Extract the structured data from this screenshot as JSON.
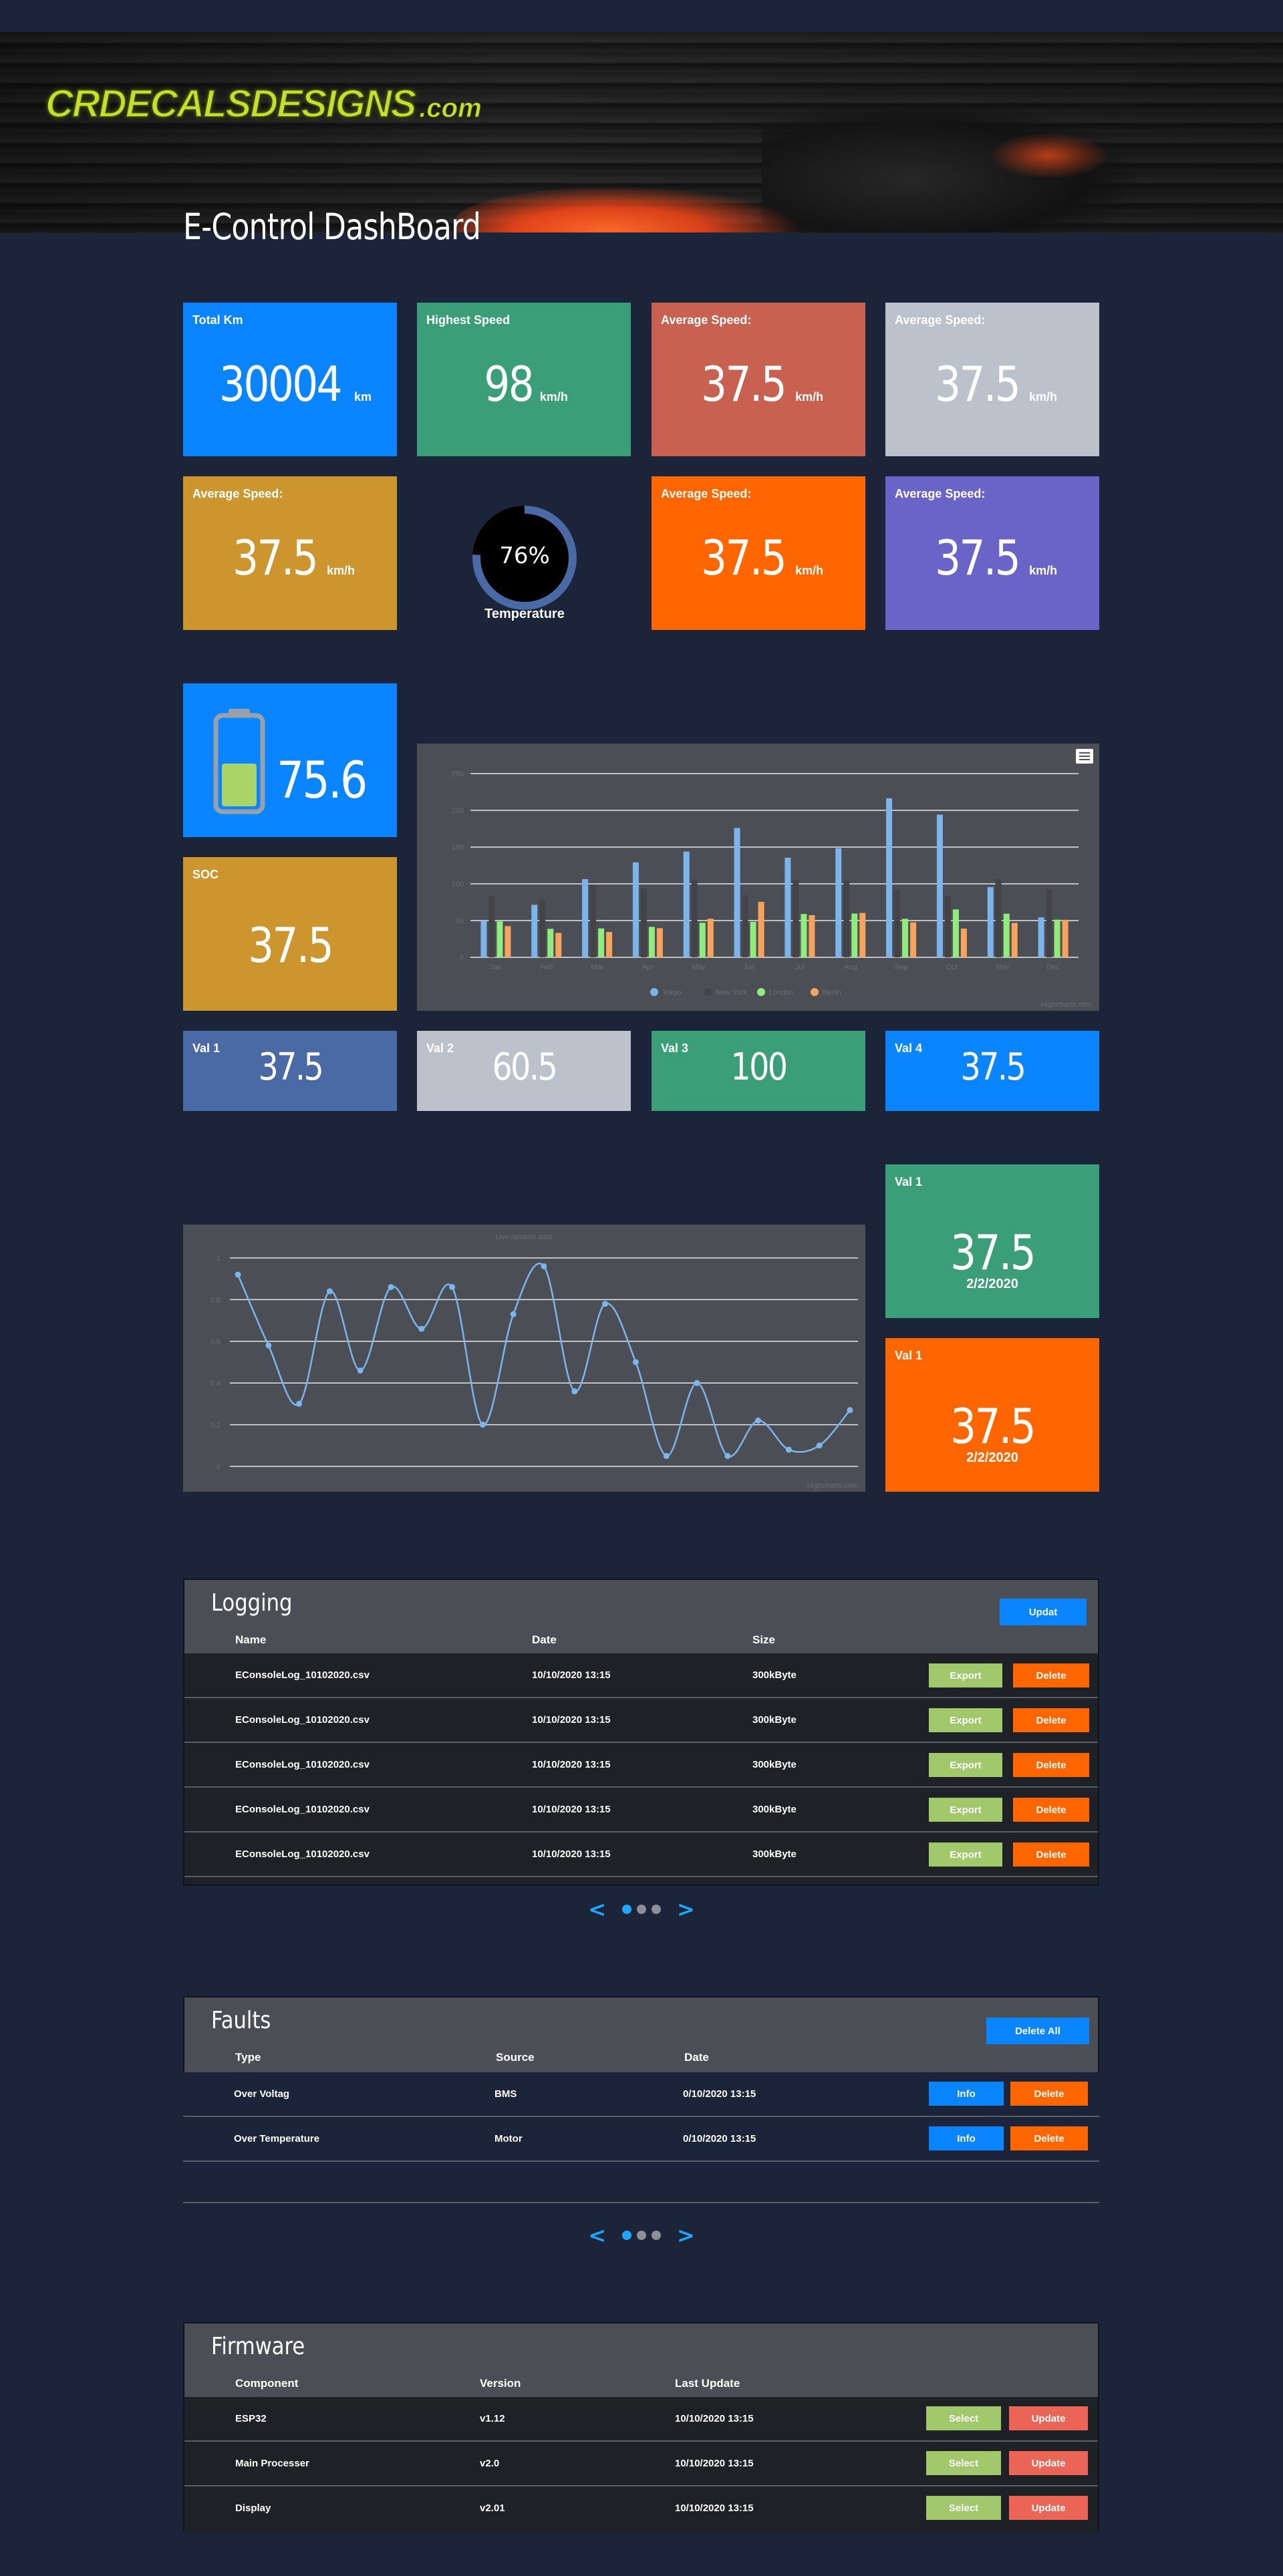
{
  "page_title": "E-Control DashBoard",
  "logo": {
    "part1": "CRDECALSDESIGNS",
    "part2": ".com"
  },
  "stats": [
    {
      "label": "Total Km",
      "value": "30004",
      "unit": "km",
      "color": "#0a84ff"
    },
    {
      "label": "Highest Speed",
      "value": "98",
      "unit": "km/h",
      "color": "#3a9e78"
    },
    {
      "label": "Average Speed:",
      "value": "37.5",
      "unit": "km/h",
      "color": "#c8614f"
    },
    {
      "label": "Average Speed:",
      "value": "37.5",
      "unit": "km/h",
      "color": "#bcc2cb"
    },
    {
      "label": "Average Speed:",
      "value": "37.5",
      "unit": "km/h",
      "color": "#cc952d"
    },
    {
      "label": "Average Speed:",
      "value": "37.5",
      "unit": "km/h",
      "color": "#ff6600"
    },
    {
      "label": "Average Speed:",
      "value": "37.5",
      "unit": "km/h",
      "color": "#6a63c8"
    }
  ],
  "gauge": {
    "percent": "76%",
    "fraction": 0.76,
    "label": "Temperature",
    "color": "#4a6aa6"
  },
  "battery": {
    "value": "75.6",
    "level": 0.5
  },
  "soc": {
    "label": "SOC",
    "value": "37.5"
  },
  "vals": [
    {
      "label": "Val 1",
      "value": "37.5",
      "color": "#4a6aa6"
    },
    {
      "label": "Val 2",
      "value": "60.5",
      "color": "#bcc2cb"
    },
    {
      "label": "Val 3",
      "value": "100",
      "color": "#3a9e78"
    },
    {
      "label": "Val 4",
      "value": "37.5",
      "color": "#0a84ff"
    }
  ],
  "side_cards": [
    {
      "label": "Val 1",
      "value": "37.5",
      "date": "2/2/2020",
      "color": "#3a9e78"
    },
    {
      "label": "Val 1",
      "value": "37.5",
      "date": "2/2/2020",
      "color": "#ff6600"
    }
  ],
  "chart_data": [
    {
      "type": "bar",
      "title": "",
      "categories": [
        "Jan",
        "Feb",
        "Mar",
        "Apr",
        "May",
        "Jun",
        "Jul",
        "Aug",
        "Sep",
        "Oct",
        "Nov",
        "Dec"
      ],
      "ylim": [
        0,
        250
      ],
      "yticks": [
        "0",
        "50",
        "100",
        "150",
        "200",
        "250"
      ],
      "series": [
        {
          "name": "Tokyo",
          "color": "#7cb5ec",
          "values": [
            49.9,
            71.5,
            106.4,
            129.2,
            144.0,
            176.0,
            135.6,
            148.5,
            216.4,
            194.1,
            95.6,
            54.4
          ]
        },
        {
          "name": "New York",
          "color": "#434348",
          "values": [
            83.6,
            78.8,
            98.5,
            93.4,
            106.0,
            84.5,
            105.0,
            104.3,
            91.2,
            83.5,
            106.6,
            92.3
          ]
        },
        {
          "name": "London",
          "color": "#90ed7d",
          "values": [
            48.9,
            38.8,
            39.3,
            41.4,
            47.0,
            48.3,
            59.0,
            59.6,
            52.4,
            65.2,
            59.3,
            51.2
          ]
        },
        {
          "name": "Berlin",
          "color": "#f7a35c",
          "values": [
            42.4,
            33.2,
            34.5,
            39.7,
            52.6,
            75.5,
            57.4,
            60.4,
            47.6,
            39.1,
            46.8,
            51.1
          ]
        }
      ],
      "grid": true,
      "legend": "bottom-center",
      "credit": "Highcharts.com"
    },
    {
      "type": "line",
      "title": "Live random data",
      "ylim": [
        0,
        1
      ],
      "yticks": [
        "0",
        "0.2",
        "0.4",
        "0.6",
        "0.8",
        "1"
      ],
      "series": [
        {
          "color": "#7cb5ec",
          "values": [
            0.92,
            0.58,
            0.3,
            0.84,
            0.46,
            0.86,
            0.66,
            0.86,
            0.2,
            0.73,
            0.96,
            0.36,
            0.78,
            0.5,
            0.05,
            0.4,
            0.05,
            0.22,
            0.08,
            0.1,
            0.27
          ]
        }
      ],
      "grid": true,
      "credit": "Highcharts.com"
    }
  ],
  "logging": {
    "title": "Logging",
    "update_label": "Updat",
    "headers": [
      "Name",
      "Date",
      "Size"
    ],
    "export_label": "Export",
    "delete_label": "Delete",
    "rows": [
      {
        "name": "EConsoleLog_10102020.csv",
        "date": "10/10/2020 13:15",
        "size": "300kByte"
      },
      {
        "name": "EConsoleLog_10102020.csv",
        "date": "10/10/2020 13:15",
        "size": "300kByte"
      },
      {
        "name": "EConsoleLog_10102020.csv",
        "date": "10/10/2020 13:15",
        "size": "300kByte"
      },
      {
        "name": "EConsoleLog_10102020.csv",
        "date": "10/10/2020 13:15",
        "size": "300kByte"
      },
      {
        "name": "EConsoleLog_10102020.csv",
        "date": "10/10/2020 13:15",
        "size": "300kByte"
      }
    ]
  },
  "faults": {
    "title": "Faults",
    "delete_all_label": "Delete All",
    "headers": [
      "Type",
      "Source",
      "Date"
    ],
    "info_label": "Info",
    "delete_label": "Delete",
    "rows": [
      {
        "type": "Over Voltag",
        "source": "BMS",
        "date": "0/10/2020 13:15"
      },
      {
        "type": "Over Temperature",
        "source": "Motor",
        "date": "0/10/2020 13:15"
      }
    ]
  },
  "firmware": {
    "title": "Firmware",
    "headers": [
      "Component",
      "Version",
      "Last Update"
    ],
    "select_label": "Select",
    "update_label": "Update",
    "rows": [
      {
        "component": "ESP32",
        "version": "v1.12",
        "date": "10/10/2020 13:15"
      },
      {
        "component": "Main Processer",
        "version": "v2.0",
        "date": "10/10/2020 13:15"
      },
      {
        "component": "Display",
        "version": "v2.01",
        "date": "10/10/2020 13:15"
      }
    ]
  },
  "pager": {
    "prev": "<",
    "next": ">"
  }
}
